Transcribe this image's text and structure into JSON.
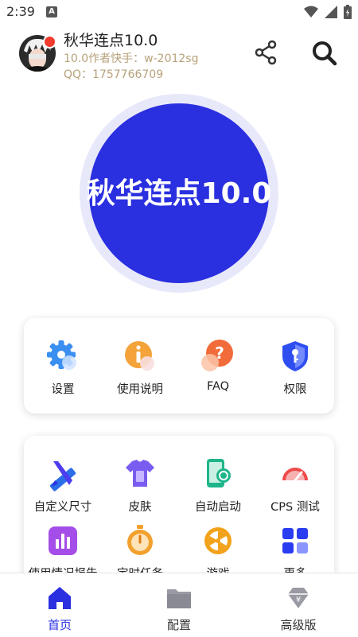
{
  "status_bar": {
    "time": "2:39",
    "notification_badge": "A"
  },
  "header": {
    "title": "秋华连点10.0",
    "subtitle_author": "10.0作者快手：w-2012sg",
    "subtitle_qq": "QQ：1757766709"
  },
  "center_button": {
    "label": "秋华连点10.0"
  },
  "grid1": [
    {
      "label": "设置",
      "icon": "gear-icon"
    },
    {
      "label": "使用说明",
      "icon": "info-icon"
    },
    {
      "label": "FAQ",
      "icon": "question-icon"
    },
    {
      "label": "权限",
      "icon": "shield-key-icon"
    }
  ],
  "grid2": [
    {
      "label": "自定义尺寸",
      "icon": "ruler-pencil-icon"
    },
    {
      "label": "皮肤",
      "icon": "tshirt-icon"
    },
    {
      "label": "自动启动",
      "icon": "phone-link-icon"
    },
    {
      "label": "CPS 测试",
      "icon": "speedometer-icon"
    },
    {
      "label": "使用情况报告",
      "icon": "bar-chart-icon"
    },
    {
      "label": "定时任务",
      "icon": "stopwatch-icon"
    },
    {
      "label": "游戏",
      "icon": "wheel-icon"
    },
    {
      "label": "更多",
      "icon": "grid-icon"
    }
  ],
  "bottom_nav": [
    {
      "label": "首页",
      "icon": "home-icon",
      "active": true
    },
    {
      "label": "配置",
      "icon": "folder-icon",
      "active": false
    },
    {
      "label": "高级版",
      "icon": "diamond-icon",
      "active": false
    }
  ],
  "colors": {
    "primary": "#2a2fe0",
    "accent_text": "#b7a27a",
    "badge": "#f23a2f"
  }
}
